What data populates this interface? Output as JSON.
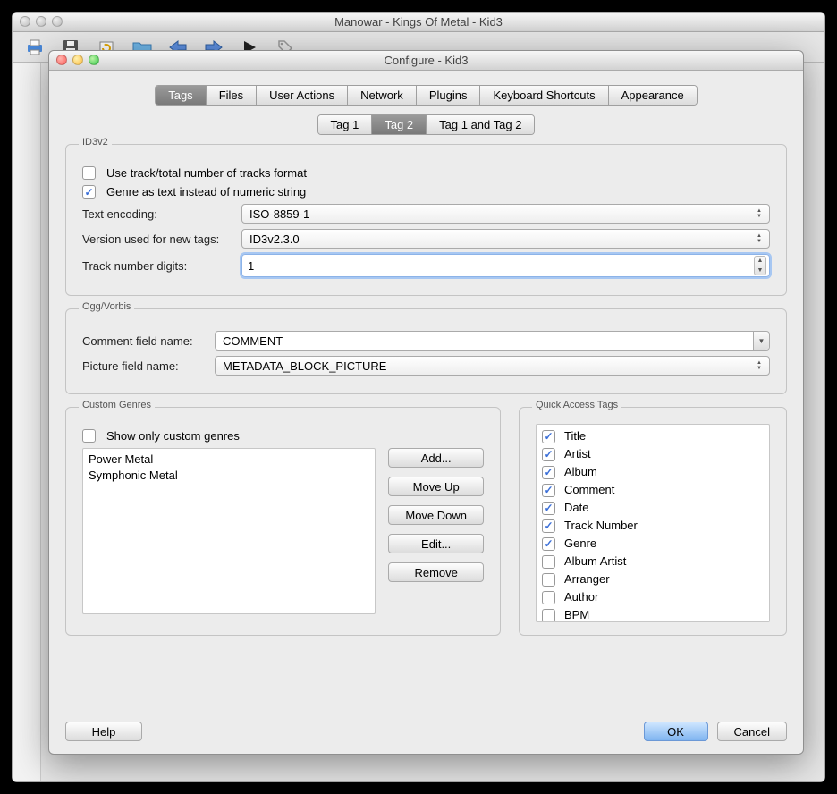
{
  "app": {
    "title": "Manowar - Kings Of Metal - Kid3"
  },
  "dialog": {
    "title": "Configure - Kid3"
  },
  "main_tabs": {
    "items": [
      "Tags",
      "Files",
      "User Actions",
      "Network",
      "Plugins",
      "Keyboard Shortcuts",
      "Appearance"
    ],
    "active": 0
  },
  "sub_tabs": {
    "items": [
      "Tag 1",
      "Tag 2",
      "Tag 1 and Tag 2"
    ],
    "active": 1
  },
  "id3v2": {
    "label": "ID3v2",
    "use_track_total": {
      "label": "Use track/total number of tracks format",
      "checked": false
    },
    "genre_text": {
      "label": "Genre as text instead of numeric string",
      "checked": true
    },
    "text_encoding": {
      "label": "Text encoding:",
      "value": "ISO-8859-1"
    },
    "version": {
      "label": "Version used for new tags:",
      "value": "ID3v2.3.0"
    },
    "track_digits": {
      "label": "Track number digits:",
      "value": "1"
    }
  },
  "ogg": {
    "label": "Ogg/Vorbis",
    "comment": {
      "label": "Comment field name:",
      "value": "COMMENT"
    },
    "picture": {
      "label": "Picture field name:",
      "value": "METADATA_BLOCK_PICTURE"
    }
  },
  "custom": {
    "label": "Custom Genres",
    "show_only": {
      "label": "Show only custom genres",
      "checked": false
    },
    "items": [
      "Power Metal",
      "Symphonic Metal"
    ],
    "btns": {
      "add": "Add...",
      "up": "Move Up",
      "down": "Move Down",
      "edit": "Edit...",
      "remove": "Remove"
    }
  },
  "quick": {
    "label": "Quick Access Tags",
    "items": [
      {
        "label": "Title",
        "checked": true
      },
      {
        "label": "Artist",
        "checked": true
      },
      {
        "label": "Album",
        "checked": true
      },
      {
        "label": "Comment",
        "checked": true
      },
      {
        "label": "Date",
        "checked": true
      },
      {
        "label": "Track Number",
        "checked": true
      },
      {
        "label": "Genre",
        "checked": true
      },
      {
        "label": "Album Artist",
        "checked": false
      },
      {
        "label": "Arranger",
        "checked": false
      },
      {
        "label": "Author",
        "checked": false
      },
      {
        "label": "BPM",
        "checked": false
      }
    ]
  },
  "footer": {
    "help": "Help",
    "ok": "OK",
    "cancel": "Cancel"
  }
}
